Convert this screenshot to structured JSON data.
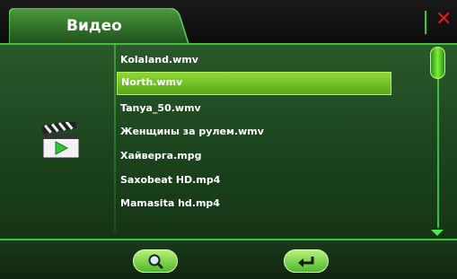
{
  "header": {
    "title": "Видео",
    "close_icon": "close-icon",
    "close_glyph": "✕"
  },
  "files": [
    {
      "name": "Kolaland.wmv",
      "selected": false
    },
    {
      "name": "North.wmv",
      "selected": true
    },
    {
      "name": "Tanya_50.wmv",
      "selected": false
    },
    {
      "name": "Женщины за рулем.wmv",
      "selected": false
    },
    {
      "name": "Хайверга.mpg",
      "selected": false
    },
    {
      "name": "Saxobeat HD.mp4",
      "selected": false
    },
    {
      "name": "Mamasita hd.mp4",
      "selected": false
    }
  ],
  "sidebar": {
    "icon": "video-clapperboard-icon"
  },
  "footer": {
    "search_icon": "search-icon",
    "back_icon": "return-arrow-icon"
  },
  "colors": {
    "accent": "#3fbf3f",
    "selection": "#7cd02e",
    "close": "#e01818",
    "background": "#1d461f"
  }
}
